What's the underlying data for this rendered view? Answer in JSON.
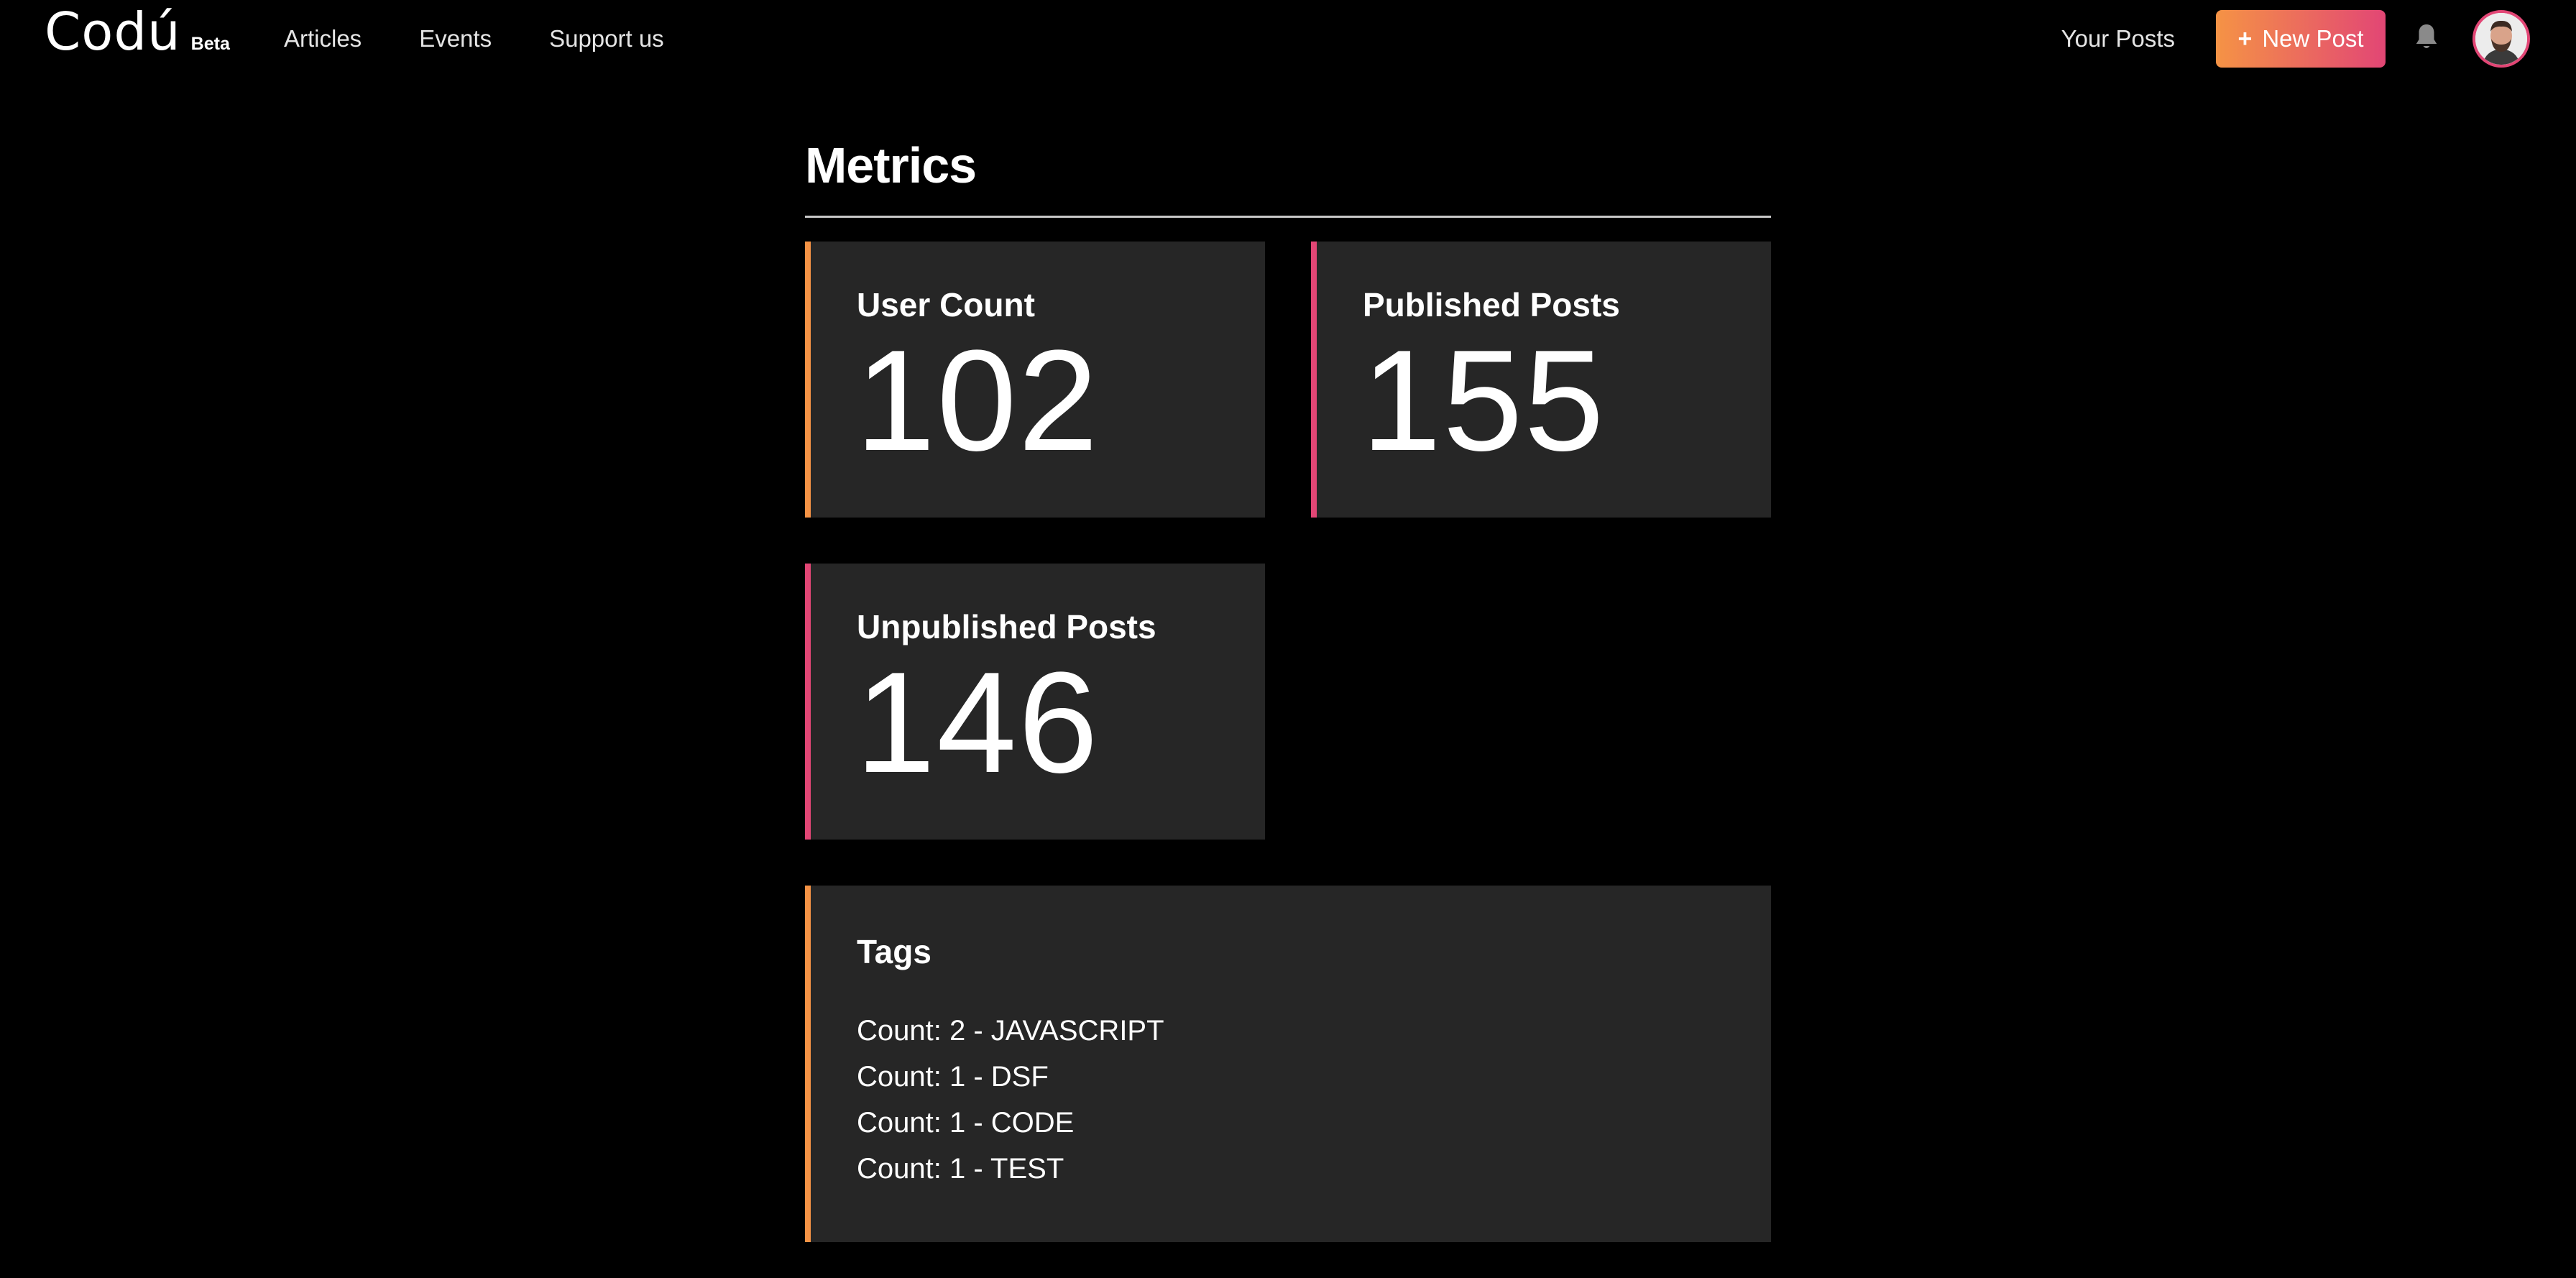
{
  "header": {
    "logo_text": "Codú",
    "logo_badge": "Beta",
    "nav": [
      {
        "label": "Articles"
      },
      {
        "label": "Events"
      },
      {
        "label": "Support us"
      }
    ],
    "your_posts_label": "Your Posts",
    "new_post_label": "New Post",
    "new_post_icon": "plus-icon",
    "notification_icon": "bell-icon",
    "avatar_icon": "user-avatar"
  },
  "main": {
    "title": "Metrics",
    "metrics": [
      {
        "label": "User Count",
        "value": "102",
        "accent": "#f59345"
      },
      {
        "label": "Published Posts",
        "value": "155",
        "accent": "#e24675"
      },
      {
        "label": "Unpublished Posts",
        "value": "146",
        "accent": "#e24675"
      }
    ],
    "tags": {
      "title": "Tags",
      "accent": "#f59345",
      "items": [
        "Count: 2 - JAVASCRIPT",
        "Count: 1 - DSF",
        "Count: 1 - CODE",
        "Count: 1 - TEST"
      ]
    }
  },
  "colors": {
    "background": "#000000",
    "card": "#262626",
    "accent_orange": "#f59345",
    "accent_pink": "#e24675"
  }
}
